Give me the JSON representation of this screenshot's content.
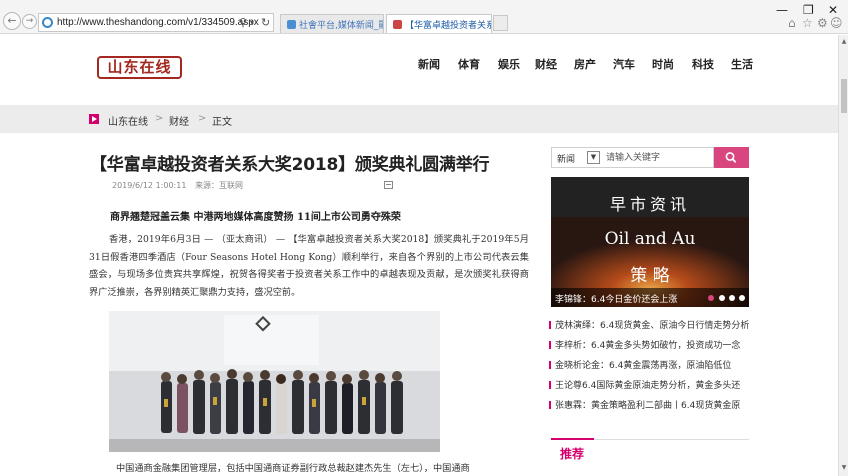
{
  "browser": {
    "url": "http://www.theshandong.com/v1/334509.aspx",
    "tabs": [
      {
        "label": "社會平台,媒体新闻_融合新闻...",
        "active": false
      },
      {
        "label": "【华富卓越投资者关系大奖...",
        "active": true
      }
    ],
    "window_controls": {
      "minimize": "—",
      "maximize": "❐",
      "close": "✕"
    }
  },
  "site": {
    "logo": "山东在线",
    "nav": [
      "新闻",
      "体育",
      "娱乐",
      "财经",
      "房产",
      "汽车",
      "时尚",
      "科技",
      "生活"
    ]
  },
  "breadcrumb": {
    "items": [
      "山东在线",
      "财经",
      "正文"
    ],
    "separator": ">"
  },
  "article": {
    "title": "【华富卓越投资者关系大奖2018】颁奖典礼圆满举行",
    "datetime": "2019/6/12 1:00:11",
    "source": "来源：互联网",
    "subtitle": "商界翘楚冠盖云集  中港两地媒体高度赞扬  11间上市公司勇夺殊荣",
    "paragraph1": "香港，2019年6月3日 — （亚太商讯） — 【华富卓越投资者关系大奖2018】颁奖典礼于2019年5月31日假香港四季酒店（Four Seasons Hotel Hong Kong）顺利举行，来自各个界别的上市公司代表云集盛会，与现场多位贵宾共享辉煌，祝贺各得奖者于投资者关系工作中的卓越表现及贡献，是次颁奖礼获得商界广泛推崇，各界别精英汇聚鼎力支持，盛况空前。",
    "paragraph2_start": "中国通商金融集团管理层，包括中国通商证券副行政总裁赵建杰先生（左七），中国通商"
  },
  "sidebar": {
    "search": {
      "scope": "新闻",
      "dropdown_icon": "▼",
      "placeholder": "请输入关键字",
      "button_icon": "search-icon"
    },
    "promo": {
      "lines": [
        "早市资讯",
        "Oil and Au",
        "策  略"
      ],
      "caption": "李锦锋：6.4今日金价还会上涨",
      "dots": 4,
      "active_dot": 0
    },
    "news": [
      "茂林演绎：6.4现货黄金、原油今日行情走势分析",
      "李梓析：6.4黄金多头势如破竹，投资成功一念",
      "金晓析论金：6.4黄金震荡再涨，原油陷低位",
      "王论尊6.4国际黄金原油走势分析，黄金多头还",
      "张惠霖：黄金策略盈利二部曲丨6.4现货黄金原"
    ],
    "recommend_label": "推荐"
  },
  "colors": {
    "accent": "#d4006e",
    "search_button": "#d9457f",
    "logo": "#a4281f"
  }
}
